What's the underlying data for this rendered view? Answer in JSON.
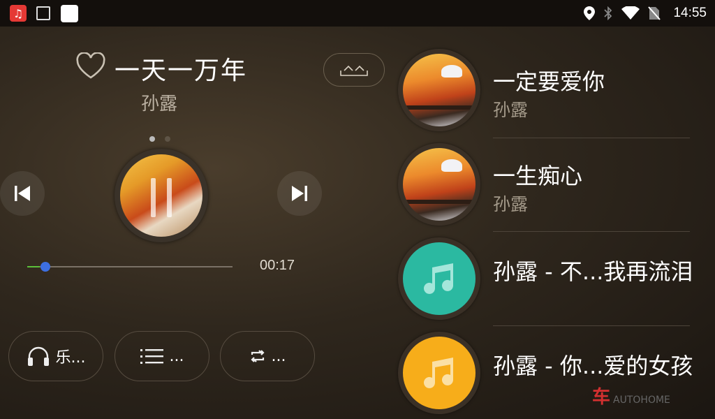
{
  "status_bar": {
    "time": "14:55",
    "icons": [
      "music-app-icon",
      "gallery-icon",
      "blank-app-icon",
      "location-icon",
      "bluetooth-icon",
      "wifi-icon",
      "no-sim-icon"
    ]
  },
  "now_playing": {
    "title": "一天一万年",
    "artist": "孙露",
    "elapsed": "00:17",
    "progress_fraction": 0.06,
    "page_dots": 2,
    "active_page": 0
  },
  "controls": {
    "pill_1_label": "乐...",
    "pill_2_label": "...",
    "pill_3_label": "..."
  },
  "playlist": [
    {
      "title": "一定要爱你",
      "artist": "孙露",
      "cover": "album-art"
    },
    {
      "title": "一生痴心",
      "artist": "孙露",
      "cover": "album-art"
    },
    {
      "title": "孙露 - 不...我再流泪",
      "artist": "",
      "cover": "music-note-teal"
    },
    {
      "title": "孙露 - 你...爱的女孩",
      "artist": "",
      "cover": "music-note-orange"
    }
  ],
  "colors": {
    "accent_green": "#5bbf3a",
    "thumb_blue": "#3d6fe0",
    "teal_cover": "#2bb9a1",
    "orange_cover": "#f7ad1a",
    "music_app_red": "#e53935"
  },
  "watermark": {
    "main": "车",
    "sub": "AUTOHOME"
  }
}
